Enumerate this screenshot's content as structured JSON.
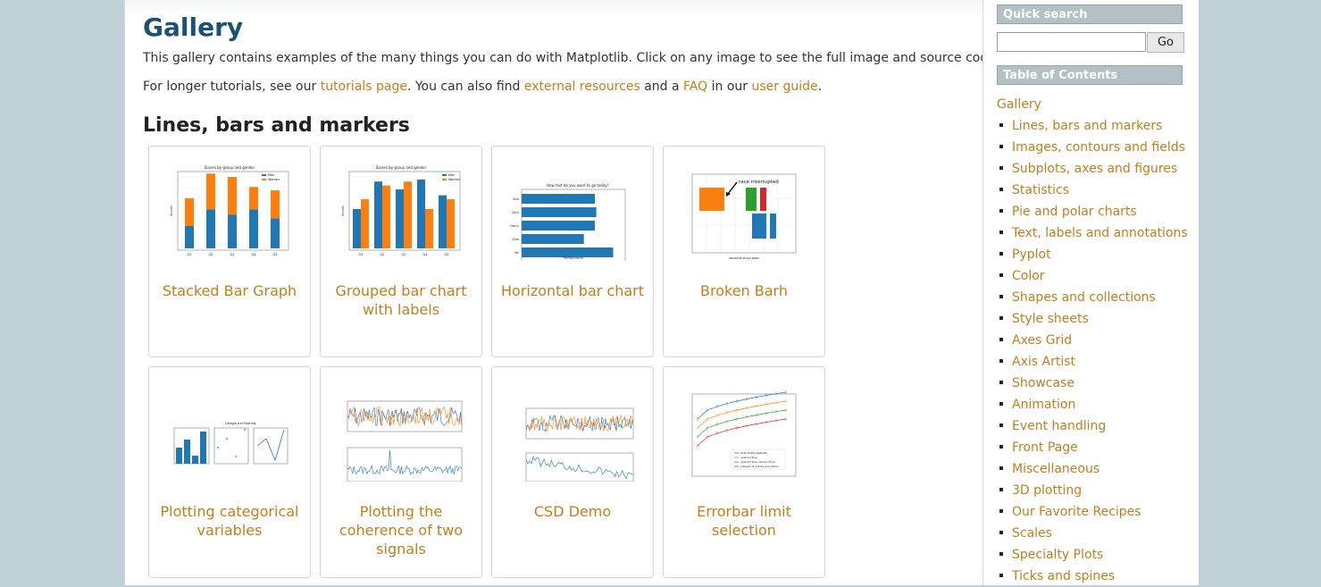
{
  "main": {
    "title": "Gallery",
    "intro": "This gallery contains examples of the many things you can do with Matplotlib. Click on any image to see the full image and source code.",
    "tutorials": {
      "prefix": "For longer tutorials, see our ",
      "link1": "tutorials page",
      "mid1": ". You can also find ",
      "link2": "external resources",
      "mid2": " and a ",
      "link3": "FAQ",
      "mid3": " in our ",
      "link4": "user guide",
      "suffix": "."
    },
    "section_title": "Lines, bars and markers",
    "cards": [
      {
        "label": "Stacked Bar Graph"
      },
      {
        "label": "Grouped bar chart with labels"
      },
      {
        "label": "Horizontal bar chart"
      },
      {
        "label": "Broken Barh"
      },
      {
        "label": "Plotting categorical variables"
      },
      {
        "label": "Plotting the coherence of two signals"
      },
      {
        "label": "CSD Demo"
      },
      {
        "label": "Errorbar limit selection"
      }
    ]
  },
  "sidebar": {
    "quick_search": "Quick search",
    "search_value": "",
    "go_label": "Go",
    "toc_title": "Table of Contents",
    "toc_root": "Gallery",
    "toc_items": [
      "Lines, bars and markers",
      "Images, contours and fields",
      "Subplots, axes and figures",
      "Statistics",
      "Pie and polar charts",
      "Text, labels and annotations",
      "Pyplot",
      "Color",
      "Shapes and collections",
      "Style sheets",
      "Axes Grid",
      "Axis Artist",
      "Showcase",
      "Animation",
      "Event handling",
      "Front Page",
      "Miscellaneous",
      "3D plotting",
      "Our Favorite Recipes",
      "Scales",
      "Specialty Plots",
      "Ticks and spines"
    ]
  },
  "thumbs": {
    "stacked": {
      "title": "Scores by group and gender",
      "legend": [
        "Men",
        "Women"
      ],
      "ylabel": "Scores",
      "groups": [
        "G1",
        "G2",
        "G3",
        "G4",
        "G5"
      ],
      "men": [
        20,
        35,
        30,
        35,
        27
      ],
      "women": [
        25,
        32,
        34,
        20,
        25
      ]
    },
    "grouped": {
      "title": "Scores by group and gender",
      "legend": [
        "Men",
        "Women"
      ],
      "ylabel": "Scores",
      "groups": [
        "G1",
        "G2",
        "G3",
        "G4",
        "G5"
      ],
      "men": [
        20,
        34,
        30,
        35,
        27
      ],
      "women": [
        25,
        32,
        34,
        20,
        25
      ]
    },
    "horizontal": {
      "title": "How fast do you want to go today?",
      "xlabel": "Performance",
      "people": [
        "Tom",
        "Dick",
        "Harry",
        "Slim",
        "Jim"
      ],
      "values": [
        10,
        10.2,
        10,
        8.5,
        12.5
      ]
    },
    "broken": {
      "annotation": "race interrupted",
      "xlabel": "seconds since start"
    },
    "categorical": {
      "title": "Categorical Plotting",
      "cats": [
        "apples",
        "oranges",
        "lemons",
        "limes"
      ],
      "values": [
        10,
        15,
        5,
        20
      ]
    },
    "errorbar": {
      "legend": [
        "both limits (default)",
        "uplims=True",
        "uplims=True, lolims=True",
        "subsets of uplims and lolims"
      ]
    }
  },
  "colors": {
    "link": "#c07f1c",
    "title": "#1a5276",
    "c1": "#1f77b4",
    "c2": "#ff7f0e",
    "c3": "#2ca02c",
    "c4": "#d62728"
  }
}
